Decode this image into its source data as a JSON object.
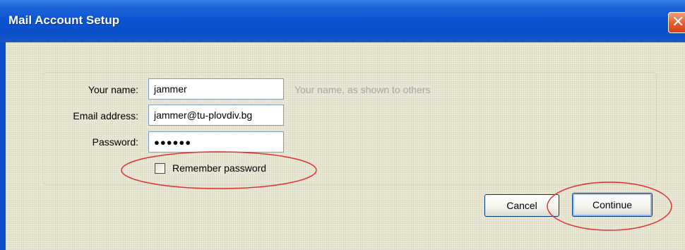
{
  "window": {
    "title": "Mail Account Setup"
  },
  "form": {
    "name_label": "Your name:",
    "name_value": "jammer",
    "name_hint": "Your name, as shown to others",
    "email_label": "Email address:",
    "email_value": "jammer@tu-plovdiv.bg",
    "password_label": "Password:",
    "password_value": "●●●●●●",
    "remember_label": "Remember password",
    "remember_checked": false
  },
  "buttons": {
    "cancel": "Cancel",
    "continue": "Continue"
  },
  "colors": {
    "titlebar": "#0a4fc8",
    "close": "#e5592e",
    "annotation": "#e03030"
  }
}
